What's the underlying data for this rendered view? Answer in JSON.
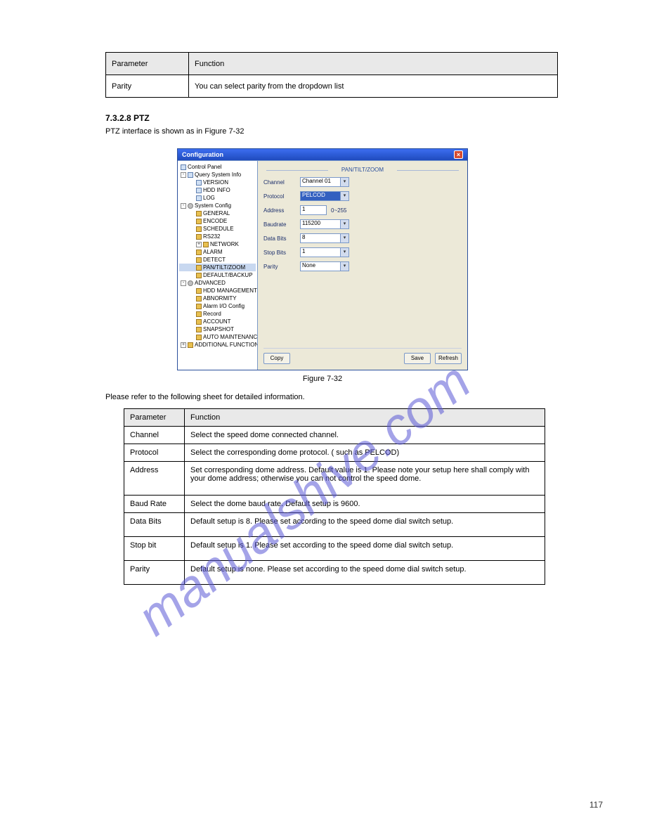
{
  "table1": {
    "col1_header": "Parameter",
    "col2_header": "Function",
    "row_label": "Parity",
    "row_value": "You can select parity from the dropdown list"
  },
  "section": {
    "title": "7.3.2.8 PTZ",
    "caption": "PTZ interface is shown as in Figure 7-32",
    "figure": "Figure 7-32",
    "ref": "Please refer to the following sheet for detailed information."
  },
  "dialog": {
    "title": "Configuration",
    "tree": {
      "root": "Control Panel",
      "qsi": "Query System Info",
      "version": "VERSION",
      "hddinfo": "HDD INFO",
      "log": "LOG",
      "sysconfig": "System Config",
      "general": "GENERAL",
      "encode": "ENCODE",
      "schedule": "SCHEDULE",
      "rs232": "RS232",
      "network": "NETWORK",
      "alarm": "ALARM",
      "detect": "DETECT",
      "ptz": "PAN/TILT/ZOOM",
      "defbkp": "DEFAULT/BACKUP",
      "advanced": "ADVANCED",
      "hddmgmt": "HDD MANAGEMENT",
      "abnorm": "ABNORMITY",
      "alarmio": "Alarm I/O Config",
      "record": "Record",
      "account": "ACCOUNT",
      "snapshot": "SNAPSHOT",
      "automaint": "AUTO MAINTENANCE",
      "addfunc": "ADDITIONAL FUNCTION"
    },
    "panel_title": "PAN/TILT/ZOOM",
    "fields": {
      "channel_l": "Channel",
      "channel_v": "Channel 01",
      "protocol_l": "Protocol",
      "protocol_v": "PELCOD",
      "address_l": "Address",
      "address_v": "1",
      "address_hint": "0~255",
      "baudrate_l": "Baudrate",
      "baudrate_v": "115200",
      "databits_l": "Data Bits",
      "databits_v": "8",
      "stopbits_l": "Stop Bits",
      "stopbits_v": "1",
      "parity_l": "Parity",
      "parity_v": "None"
    },
    "buttons": {
      "copy": "Copy",
      "save": "Save",
      "refresh": "Refresh"
    }
  },
  "table2": {
    "h1": "Parameter",
    "h2": "Function",
    "rows": [
      {
        "p": "Channel",
        "f": "Select the speed dome connected channel."
      },
      {
        "p": "Protocol",
        "f": "Select the corresponding dome protocol. ( such as PELCOD)"
      },
      {
        "p": "Address",
        "f": "Set corresponding dome address. Default value is 1. Please note your setup here shall comply with your dome address; otherwise you can not control the speed dome."
      },
      {
        "p": "Baud Rate",
        "f": "Select the dome baud rate. Default setup is 9600."
      },
      {
        "p": "Data Bits",
        "f": "Default setup is 8. Please set according to the speed dome dial switch setup."
      },
      {
        "p": "Stop bit",
        "f": "Default setup is 1. Please set according to the speed dome dial switch setup."
      },
      {
        "p": "Parity",
        "f": "Default setup is none. Please set according to the speed dome dial switch setup."
      }
    ]
  },
  "watermark_text": "manualshive.com",
  "page": "117"
}
